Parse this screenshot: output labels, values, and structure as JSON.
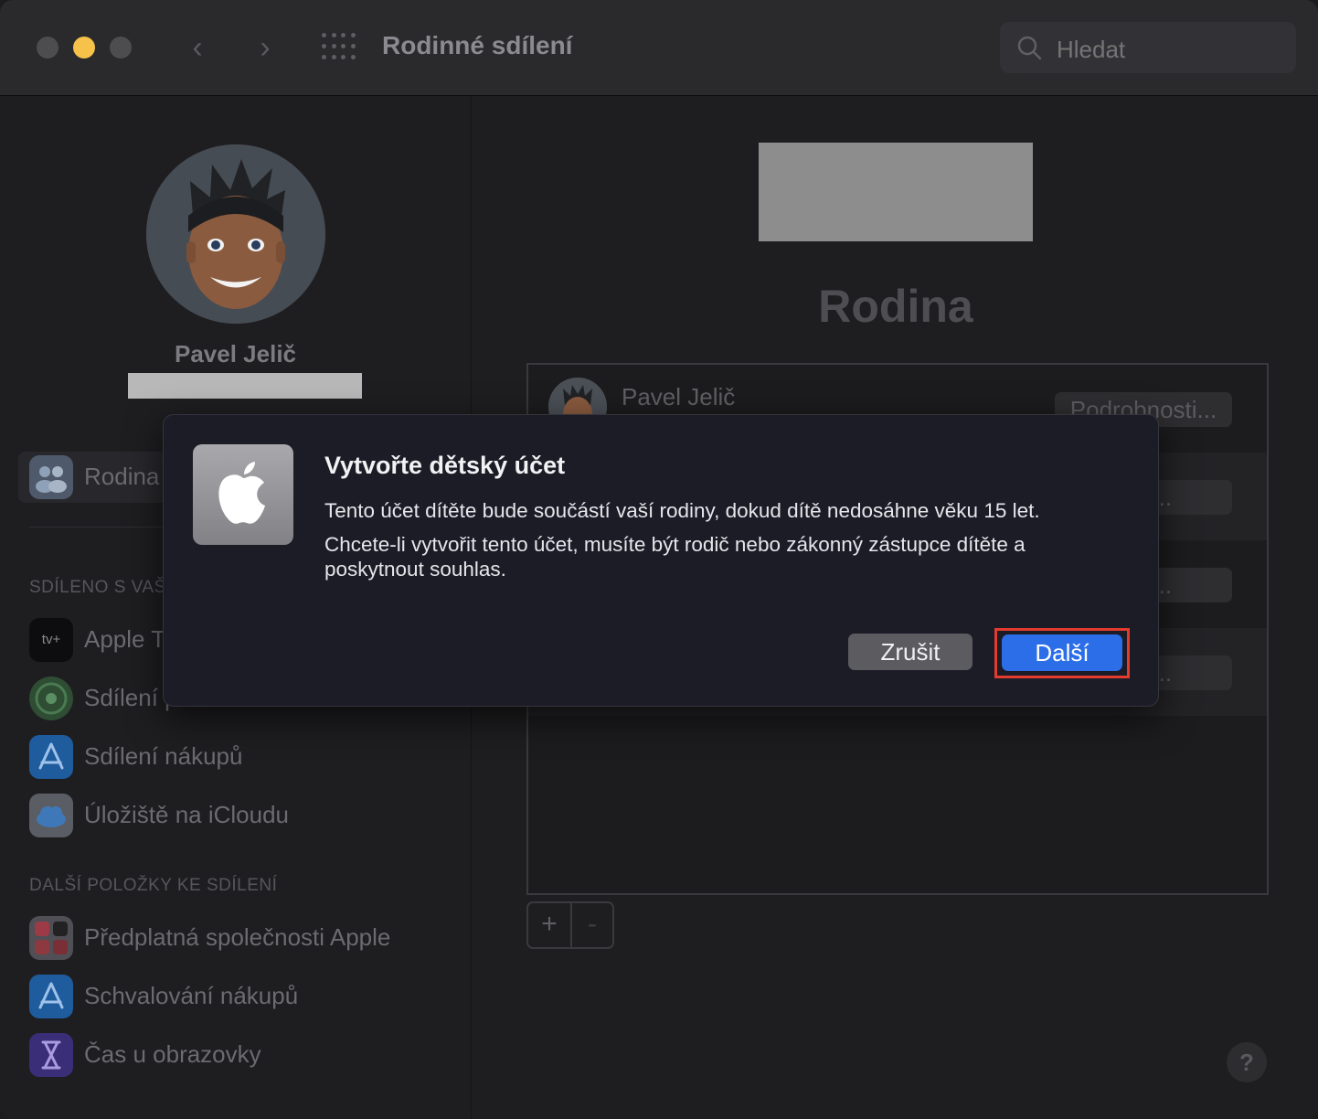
{
  "window": {
    "title": "Rodinné sdílení",
    "search_placeholder": "Hledat"
  },
  "sidebar": {
    "profile_name": "Pavel Jelič",
    "selected_item": "Rodina",
    "section_shared": "SDÍLENO S VAŠ",
    "shared_items": [
      {
        "label": "Apple T",
        "icon": "apple-tv-icon"
      },
      {
        "label": "Sdílení p",
        "icon": "find-my-icon"
      },
      {
        "label": "Sdílení nákupů",
        "icon": "app-store-icon"
      },
      {
        "label": "Úložiště na iCloudu",
        "icon": "icloud-icon"
      }
    ],
    "section_more": "DALŠÍ POLOŽKY KE SDÍLENÍ",
    "more_items": [
      {
        "label": "Předplatná společnosti Apple",
        "icon": "apple-subscriptions-icon"
      },
      {
        "label": "Schvalování nákupů",
        "icon": "ask-to-buy-icon"
      },
      {
        "label": "Čas u obrazovky",
        "icon": "screen-time-icon"
      }
    ],
    "apple_tv_badge": "tv+"
  },
  "main": {
    "title": "Rodina",
    "members": [
      {
        "name": "Pavel Jelič",
        "button": "Podrobnosti..."
      },
      {
        "name": "",
        "button": "osti..."
      },
      {
        "name": "",
        "button": "osti..."
      },
      {
        "name": "",
        "button": "osti..."
      }
    ],
    "add_label": "+",
    "remove_label": "-",
    "help_label": "?"
  },
  "dialog": {
    "title": "Vytvořte dětský účet",
    "message1": "Tento účet dítěte bude součástí vaší rodiny, dokud dítě nedosáhne věku 15 let.",
    "message2": "Chcete-li vytvořit tento účet, musíte být rodič nebo zákonný zástupce dítěte a poskytnout souhlas.",
    "cancel": "Zrušit",
    "next": "Další",
    "highlight_color": "#e43b2f",
    "primary_color": "#2b6ee8"
  }
}
